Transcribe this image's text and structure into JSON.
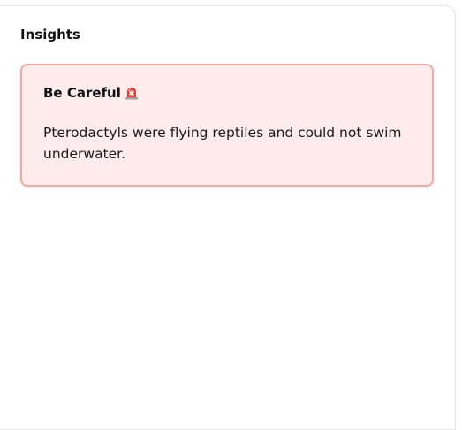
{
  "panel": {
    "title": "Insights"
  },
  "alert": {
    "title": "Be Careful",
    "icon": "siren-icon",
    "message": "Pterodactyls were flying reptiles and could not swim underwater.",
    "colors": {
      "background": "#fdeceb",
      "border": "#f0aaa4",
      "icon_red": "#e53935"
    }
  }
}
